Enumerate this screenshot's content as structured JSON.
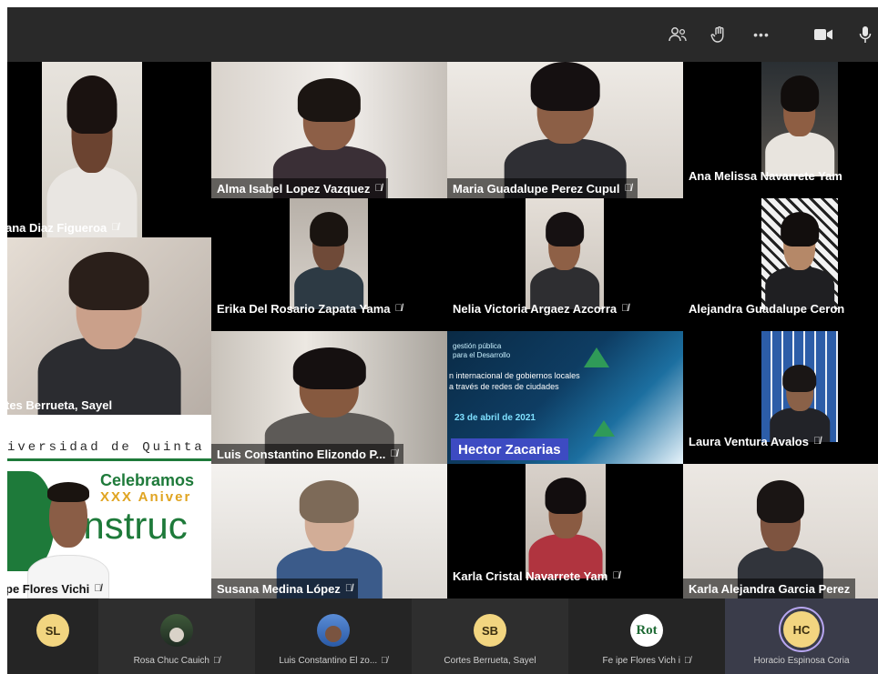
{
  "colors": {
    "topbar": "#292929",
    "strip": "#252525",
    "label_bg": "rgba(0,0,0,0.55)",
    "avatar_yellow": "#f2d580",
    "avatar_speaking_ring": "#b7a6f0"
  },
  "toolbar": {
    "icons": [
      "participants-icon",
      "raise-hand-icon",
      "more-options-icon",
      "camera-icon",
      "microphone-icon"
    ],
    "more_label": "•••"
  },
  "grid": {
    "tiles": [
      {
        "id": "t1",
        "name": "ana Diaz Figueroa",
        "muted": true
      },
      {
        "id": "t2",
        "name": "Alma Isabel Lopez Vazquez",
        "muted": true
      },
      {
        "id": "t3",
        "name": "Maria Guadalupe Perez Cupul",
        "muted": true
      },
      {
        "id": "t4",
        "name": "Ana Melissa Navarrete Yam",
        "muted": false
      },
      {
        "id": "t5",
        "name": "Erika Del Rosario Zapata Yama",
        "muted": true
      },
      {
        "id": "t6",
        "name": "Nelia Victoria Argaez Azcorra",
        "muted": true
      },
      {
        "id": "t7",
        "name": "Alejandra Guadalupe Ceron",
        "muted": false
      },
      {
        "id": "t8",
        "name": "tes Berrueta, Sayel",
        "muted": false
      },
      {
        "id": "t9",
        "name": "Luis Constantino  Elizondo P...",
        "muted": true
      },
      {
        "id": "t10",
        "name": "Hector Zacarias",
        "muted": false
      },
      {
        "id": "t11",
        "name": "Laura Ventura Avalos",
        "muted": true
      },
      {
        "id": "t12",
        "name": "pe  Flores Vichi",
        "muted": true
      },
      {
        "id": "t13",
        "name": "Susana Medina López",
        "muted": true
      },
      {
        "id": "t14",
        "name": "Karla Cristal Navarrete Yam",
        "muted": true
      },
      {
        "id": "t15",
        "name": "Karla Alejandra Garcia Perez",
        "muted": false
      }
    ],
    "banner": {
      "line1": "iversidad de Quinta",
      "line2": "Celebramos",
      "line3": "XXX Aniver",
      "line4": "onstruc"
    },
    "poster": {
      "l1": "gestión pública",
      "l2": "para el Desarrollo",
      "l3": "n internacional de gobiernos locales",
      "l4": "a través de redes de ciudades",
      "date": "23 de abril de 2021"
    }
  },
  "participants_strip": [
    {
      "initials": "SL",
      "name": "",
      "avatar": "initials"
    },
    {
      "initials": "",
      "name": "Rosa Chuc Cauich",
      "avatar": "photo"
    },
    {
      "initials": "",
      "name": "Luis Constantino El zo...",
      "avatar": "photo"
    },
    {
      "initials": "SB",
      "name": "Cortes Berrueta, Sayel",
      "avatar": "initials"
    },
    {
      "initials": "",
      "name": "Fe ipe Flores Vich i",
      "avatar": "logo",
      "logo_text": "Rot"
    },
    {
      "initials": "HC",
      "name": "Horacio Espinosa Coria",
      "avatar": "initials-speaking"
    }
  ]
}
